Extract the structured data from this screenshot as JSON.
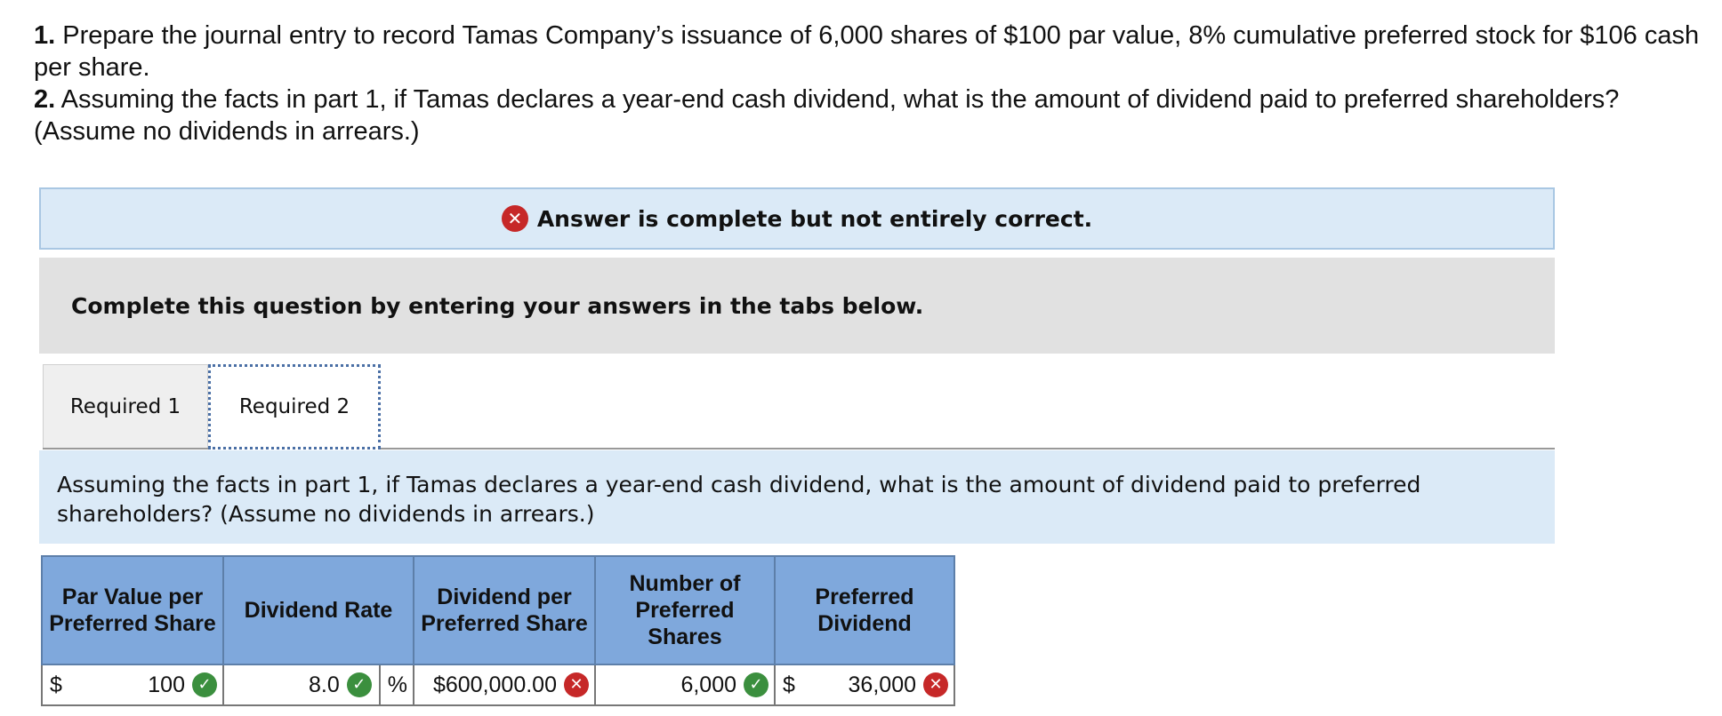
{
  "question": {
    "p1_num": "1.",
    "p1_text": "Prepare the journal entry to record Tamas Company’s issuance of 6,000 shares of $100 par value, 8% cumulative preferred stock for $106 cash per share.",
    "p2_num": "2.",
    "p2_text": "Assuming the facts in part 1, if Tamas declares a year-end cash dividend, what is the amount of dividend paid to preferred shareholders? (Assume no dividends in arrears.)"
  },
  "banner": {
    "icon": "x-circle-icon",
    "message": "Answer is complete but not entirely correct.",
    "color": "#c62828"
  },
  "instruction": "Complete this question by entering your answers in the tabs below.",
  "tabs": [
    {
      "label": "Required 1",
      "active": false
    },
    {
      "label": "Required 2",
      "active": true
    }
  ],
  "required_text": "Assuming the facts in part 1, if Tamas declares a year-end cash dividend, what is the amount of dividend paid to preferred shareholders? (Assume no dividends in arrears.)",
  "table": {
    "headers": [
      "Par Value per Preferred Share",
      "Dividend Rate",
      "Dividend per Preferred Share",
      "Number of Preferred Shares",
      "Preferred Dividend"
    ],
    "row": {
      "par_currency": "$",
      "par_value": "100",
      "par_status": "correct",
      "rate_value": "8.0",
      "rate_status": "correct",
      "rate_unit": "%",
      "dps_value": "$600,000.00",
      "dps_status": "incorrect",
      "shares_value": "6,000",
      "shares_status": "correct",
      "dividend_currency": "$",
      "dividend_value": "36,000",
      "dividend_status": "incorrect"
    }
  },
  "colors": {
    "correct": "#3b8f3e",
    "incorrect": "#c62828",
    "header_bg": "#7fa8dc",
    "panel_bg": "#dbeaf7"
  }
}
